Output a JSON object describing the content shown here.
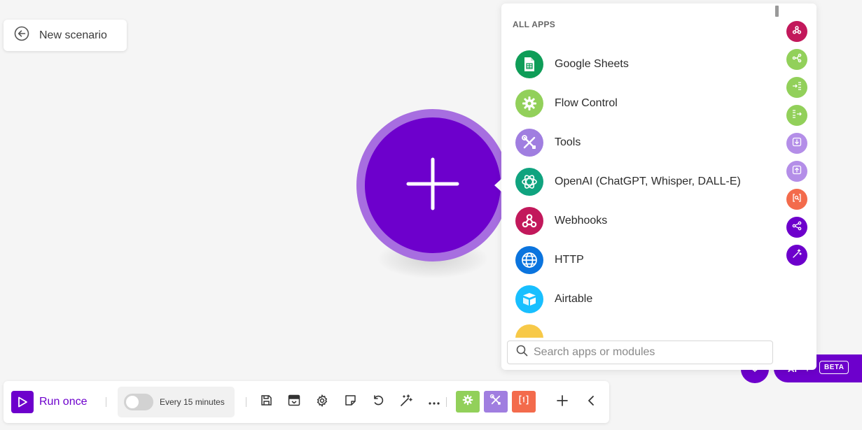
{
  "back_button": {
    "label": "New scenario",
    "icon": "arrow-left-circle-icon"
  },
  "canvas": {
    "add_module_icon": "plus-icon",
    "node_color": "#6d00cc",
    "node_ring_color": "#a76ee0"
  },
  "picker": {
    "heading": "ALL APPS",
    "apps": [
      {
        "label": "Google Sheets",
        "color": "#0f9d58",
        "icon": "google-sheets-icon"
      },
      {
        "label": "Flow Control",
        "color": "#92d05a",
        "icon": "flow-control-gear-icon"
      },
      {
        "label": "Tools",
        "color": "#a07ee0",
        "icon": "tools-icon"
      },
      {
        "label": "OpenAI (ChatGPT, Whisper, DALL-E)",
        "color": "#10a37f",
        "icon": "openai-icon"
      },
      {
        "label": "Webhooks",
        "color": "#c2185b",
        "icon": "webhooks-icon"
      },
      {
        "label": "HTTP",
        "color": "#0b74de",
        "icon": "globe-icon"
      },
      {
        "label": "Airtable",
        "color": "#18bfff",
        "icon": "airtable-icon"
      },
      {
        "label": "",
        "color": "#f7c948",
        "icon": "partially-visible-app-icon"
      }
    ],
    "search": {
      "placeholder": "Search apps or modules",
      "value": ""
    },
    "side_buttons": [
      {
        "icon": "webhooks-icon",
        "color": "#c2185b"
      },
      {
        "icon": "router-icon",
        "color": "#92d05a"
      },
      {
        "icon": "iterator-icon",
        "color": "#92d05a"
      },
      {
        "icon": "aggregator-icon",
        "color": "#92d05a"
      },
      {
        "icon": "download-box-icon",
        "color": "#b48ee8"
      },
      {
        "icon": "upload-box-icon",
        "color": "#b48ee8"
      },
      {
        "icon": "text-parser-icon",
        "color": "#f36b4c"
      },
      {
        "icon": "share-icon",
        "color": "#6d00cc"
      },
      {
        "icon": "magic-wand-icon",
        "color": "#6d00cc"
      }
    ]
  },
  "ai_assistant": {
    "label": "AI",
    "badge": "BETA",
    "color": "#6d00cc"
  },
  "toolbar": {
    "run_label": "Run once",
    "schedule_label": "Every 15 minutes",
    "schedule_enabled": false,
    "icons": [
      "save-icon",
      "blueprint-icon",
      "settings-gear-icon",
      "notes-icon",
      "undo-icon",
      "auto-align-wand-icon",
      "more-dots-icon"
    ],
    "tiles": [
      {
        "icon": "flow-control-gear-icon",
        "color": "#92d05a"
      },
      {
        "icon": "tools-icon",
        "color": "#a07ee0"
      },
      {
        "icon": "text-parser-icon",
        "color": "#f36b4c"
      }
    ],
    "add_icon": "plus-icon",
    "collapse_icon": "chevron-left-icon"
  }
}
